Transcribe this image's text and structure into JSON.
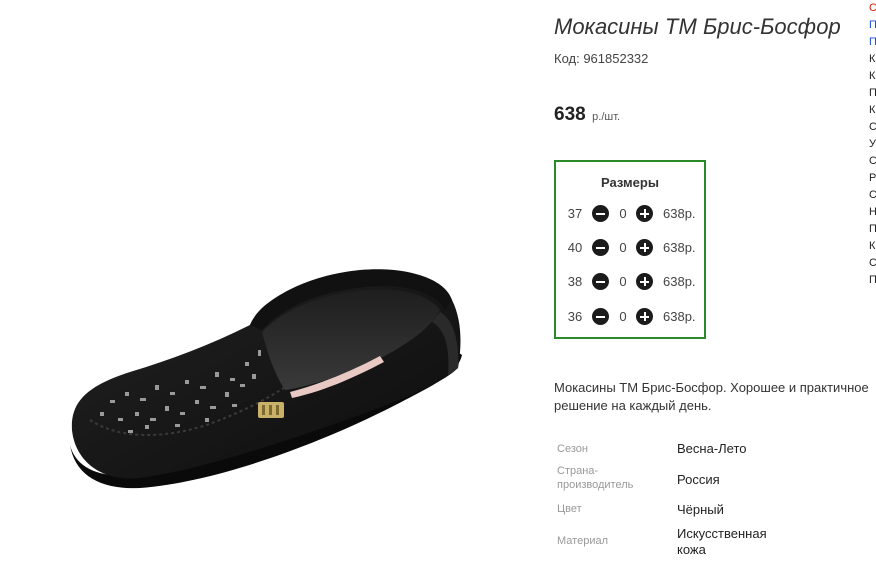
{
  "product": {
    "title": "Мокасины ТМ Брис-Босфор",
    "code": "Код: 961852332",
    "price": "638",
    "price_unit": "р./шт.",
    "sizes_title": "Размеры",
    "sizes": [
      {
        "size": "37",
        "qty": "0",
        "price": "638р."
      },
      {
        "size": "40",
        "qty": "0",
        "price": "638р."
      },
      {
        "size": "38",
        "qty": "0",
        "price": "638р."
      },
      {
        "size": "36",
        "qty": "0",
        "price": "638р."
      }
    ],
    "description": "Мокасины ТМ Брис-Босфор. Хорошее и практичное решение на каждый день.",
    "attributes": [
      {
        "label": "Сезон",
        "value": "Весна-Лето"
      },
      {
        "label": "Страна-производитель",
        "value": "Россия"
      },
      {
        "label": "Цвет",
        "value": "Чёрный"
      },
      {
        "label": "Материал",
        "value": "Искусственная кожа"
      }
    ]
  },
  "right_column": {
    "letters": [
      "С",
      "П",
      "П",
      "К",
      "К",
      "П",
      "К",
      "С",
      "У",
      "С",
      "Р",
      "С",
      "Н",
      "П",
      "К",
      "С",
      "П"
    ],
    "colors": {
      "first": "#cc2200",
      "links": "#1a4fd0",
      "text": "#222222"
    }
  },
  "colors": {
    "sizes_border": "#2a8a2a",
    "button": "#1b1b1b"
  }
}
